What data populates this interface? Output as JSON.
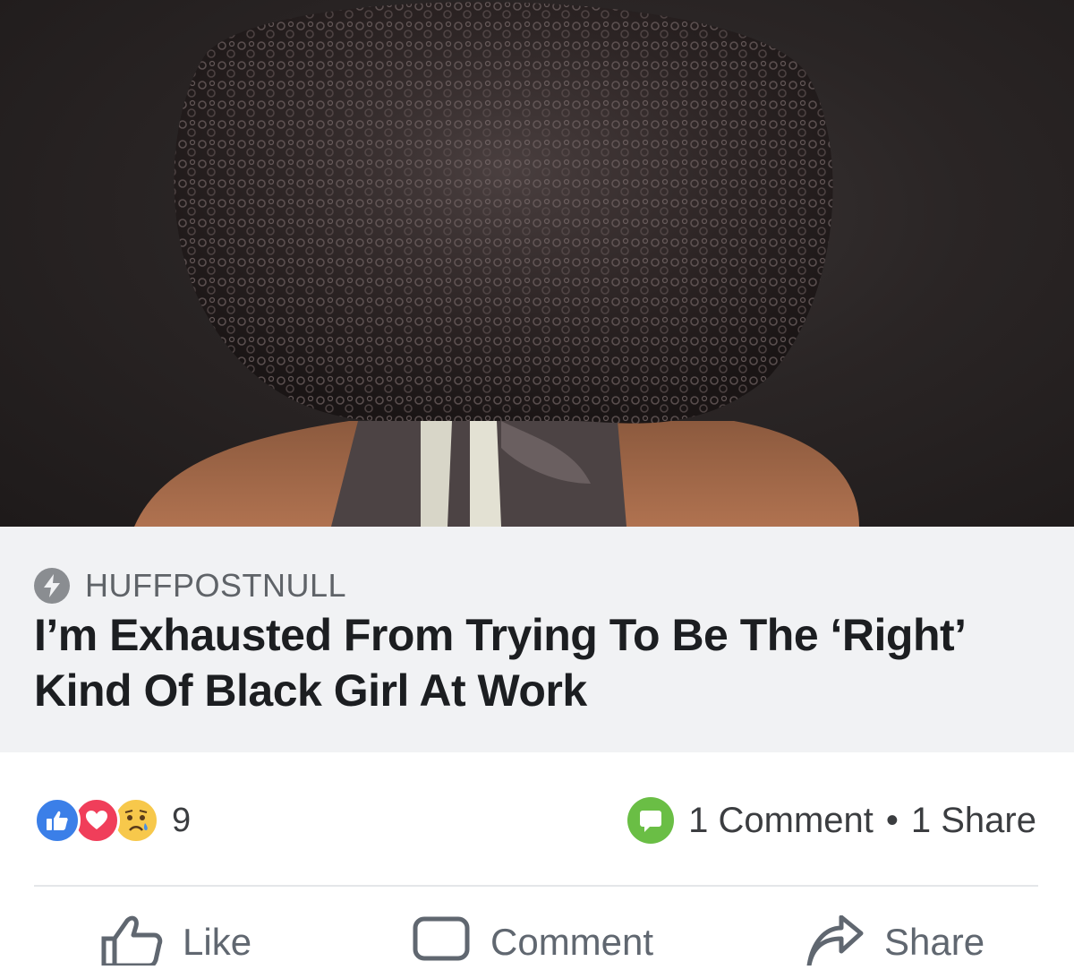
{
  "post": {
    "image": {
      "subject": "natural-hair-back-view-photo"
    },
    "preview": {
      "source_icon": "lightning-bolt-icon",
      "source": "HUFFPOSTNULL",
      "headline": "I’m Exhausted From Trying To Be The ‘Right’ Kind Of Black Girl At Work"
    },
    "reactions": {
      "types": [
        "like",
        "love",
        "sad"
      ],
      "count": "9",
      "colors": {
        "like": "#3b7fe8",
        "love": "#f03e5a",
        "sad": "#f7c84b"
      }
    },
    "engagement": {
      "comments_label": "1 Comment",
      "separator": "•",
      "shares_label": "1 Share",
      "comment_badge_color": "#6abe45"
    },
    "actions": [
      {
        "label": "Like",
        "icon": "thumbs-up-icon"
      },
      {
        "label": "Comment",
        "icon": "comment-bubble-icon"
      },
      {
        "label": "Share",
        "icon": "share-arrow-icon"
      }
    ]
  }
}
